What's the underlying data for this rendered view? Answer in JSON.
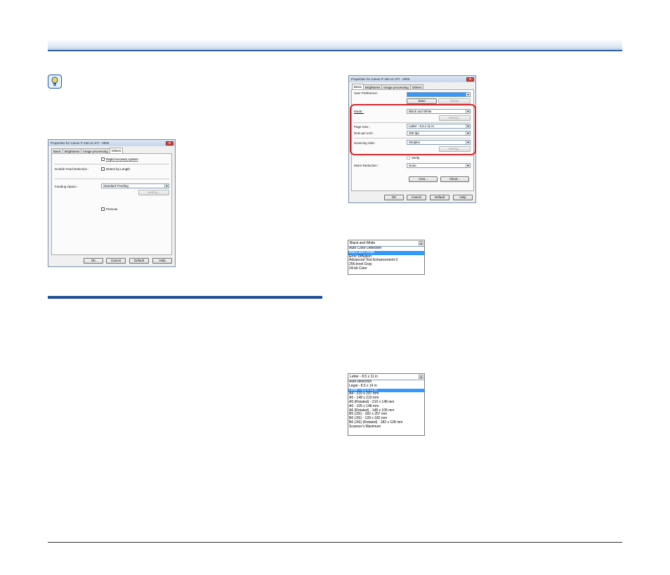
{
  "dialog_others": {
    "title": "Properties for Canon P-150 on STI - 0000",
    "close": "✕",
    "tabs": [
      "Basic",
      "Brightness",
      "Image processing",
      "Others"
    ],
    "rapid_recovery": "Rapid recovery system",
    "double_feed_label": "Double Feed Detection :",
    "detect_by_length": "Detect by Length",
    "feeding_option_label": "Feeding Option :",
    "feeding_option_value": "Standard Feeding",
    "setting": "Setting...",
    "prescan": "Prescan",
    "buttons": [
      "OK",
      "Cancel",
      "Default",
      "Help"
    ]
  },
  "dialog_basic": {
    "title": "Properties for Canon P-150 on STI - 0000",
    "close": "✕",
    "tabs": [
      "Basic",
      "Brightness",
      "Image processing",
      "Others"
    ],
    "user_preference_label": "User Preference:",
    "save": "Save",
    "delete": "Delete",
    "mode_label": "Mode :",
    "mode_value": "Black and White",
    "page_size_label": "Page Size :",
    "page_size_value": "Letter - 8.5 x 11 in",
    "dpi_label": "Dots per inch :",
    "dpi_value": "200 dpi",
    "scanning_side_label": "Scanning Side :",
    "scanning_side_value": "Simplex",
    "setting": "Setting...",
    "verify": "Verify",
    "moire_label": "Moire Reduction :",
    "moire_value": "None",
    "area": "Area...",
    "about": "About...",
    "buttons": [
      "OK",
      "Cancel",
      "Default",
      "Help"
    ]
  },
  "mode_list": {
    "selected": "Black and White",
    "options": [
      "Auto Color Detection",
      "Black and White",
      "Error Diffusion",
      "Advanced Text Enhancement II",
      "256-level Gray",
      "24-bit Color"
    ],
    "highlighted_index": 1
  },
  "page_size_list": {
    "selected": "Letter - 8.5 x 11 in",
    "options": [
      "Auto-detection",
      "Legal - 8.5 x 14 in",
      "Letter - 8.5 x 11 in",
      "A4 - 210 x 297 mm",
      "A5 - 148 x 210 mm",
      "A5 (Rotated) - 210 x 148 mm",
      "A6 - 105 x 148 mm",
      "A6 (Rotated) - 148 x 105 mm",
      "B5 (JIS) - 182 x 257 mm",
      "B6 (JIS) - 128 x 182 mm",
      "B6 (JIS) (Rotated) - 182 x 128 mm",
      "Scanner's Maximum"
    ],
    "highlighted_index": 2
  },
  "icons": {
    "hint": "lightbulb-icon",
    "close": "close-icon",
    "dropdown": "chevron-down-icon"
  },
  "colors": {
    "header_rule": "#2f5fa3",
    "section_rule": "#1f4f96",
    "highlight": "#d9262a",
    "selection": "#3399ff"
  }
}
